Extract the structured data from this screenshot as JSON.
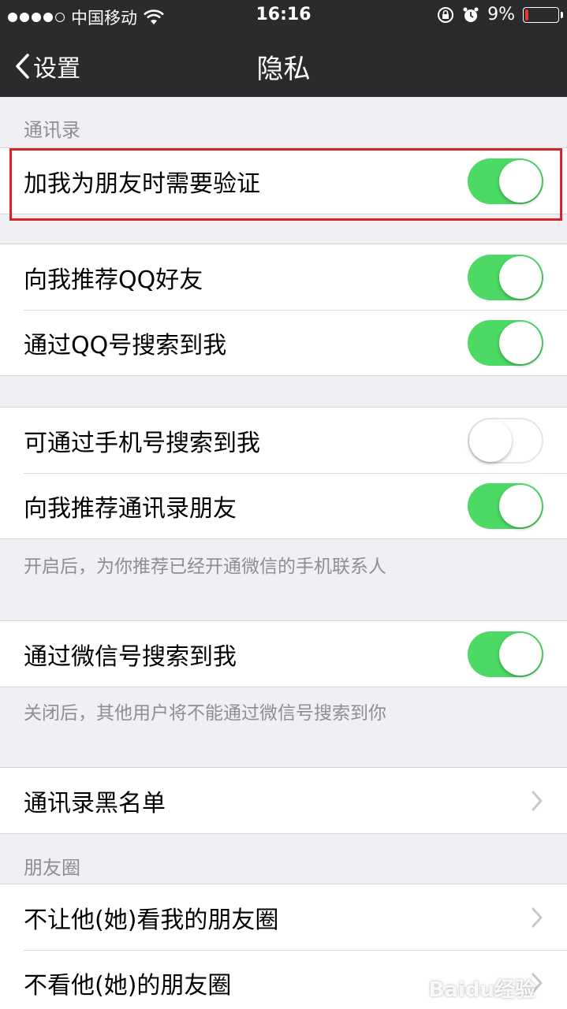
{
  "status_bar": {
    "carrier": "中国移动",
    "time": "16:16",
    "battery_percent": "9%",
    "battery_level": 0.09
  },
  "nav": {
    "back_label": "设置",
    "title": "隐私"
  },
  "sections": {
    "contacts_header": "通讯录",
    "moments_header": "朋友圈"
  },
  "rows": {
    "verify": {
      "label": "加我为朋友时需要验证",
      "on": true
    },
    "recommend_qq": {
      "label": "向我推荐QQ好友",
      "on": true
    },
    "search_by_qq": {
      "label": "通过QQ号搜索到我",
      "on": true
    },
    "search_by_phone": {
      "label": "可通过手机号搜索到我",
      "on": false
    },
    "recommend_contacts": {
      "label": "向我推荐通讯录朋友",
      "on": true
    },
    "search_by_wechat": {
      "label": "通过微信号搜索到我",
      "on": true
    },
    "blacklist": {
      "label": "通讯录黑名单"
    },
    "hide_moments": {
      "label": "不让他(她)看我的朋友圈"
    },
    "dont_see_moments": {
      "label": "不看他(她)的朋友圈"
    }
  },
  "notes": {
    "contacts_note": "开启后，为你推荐已经开通微信的手机联系人",
    "wechat_note": "关闭后，其他用户将不能通过微信号搜索到你"
  },
  "watermark": "Baidu经验",
  "colors": {
    "toggle_on": "#4cd964",
    "nav_bg": "#2b2b2d",
    "highlight": "#d0262c"
  }
}
